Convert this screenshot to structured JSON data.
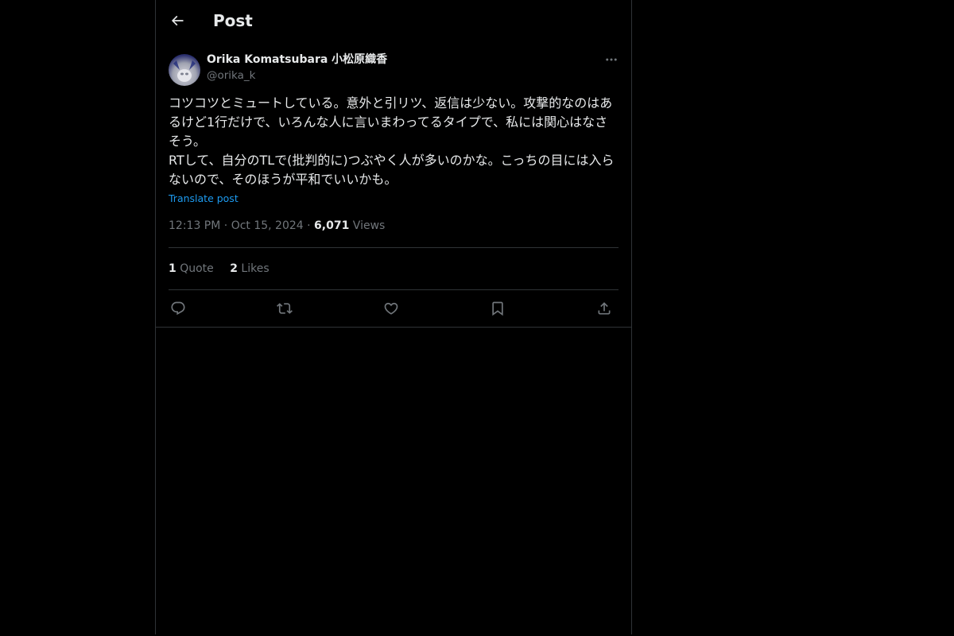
{
  "header": {
    "title": "Post"
  },
  "post": {
    "author_name": "Orika Komatsubara 小松原織香",
    "author_handle": "@orika_k",
    "paragraphs": [
      "コツコツとミュートしている。意外と引リツ、返信は少ない。攻撃的なのはあるけど1行だけで、いろんな人に言いまわってるタイプで、私には関心はなさそう。",
      "RTして、自分のTLで(批判的に)つぶやく人が多いのかな。こっちの目には入らないので、そのほうが平和でいいかも。"
    ],
    "translate_label": "Translate post",
    "time": "12:13 PM",
    "date": "Oct 15, 2024",
    "views_count": "6,071",
    "views_label": "Views",
    "separator": " · "
  },
  "stats": {
    "quotes_count": "1",
    "quotes_label": "Quote",
    "likes_count": "2",
    "likes_label": "Likes"
  },
  "icons": {
    "back": "back-arrow-icon",
    "more": "more-icon",
    "reply": "reply-icon",
    "repost": "repost-icon",
    "like": "heart-icon",
    "bookmark": "bookmark-icon",
    "share": "share-icon"
  },
  "colors": {
    "background": "#000000",
    "text_primary": "#e7e9ea",
    "text_secondary": "#71767b",
    "accent": "#1d9bf0",
    "border": "#2f3336"
  }
}
